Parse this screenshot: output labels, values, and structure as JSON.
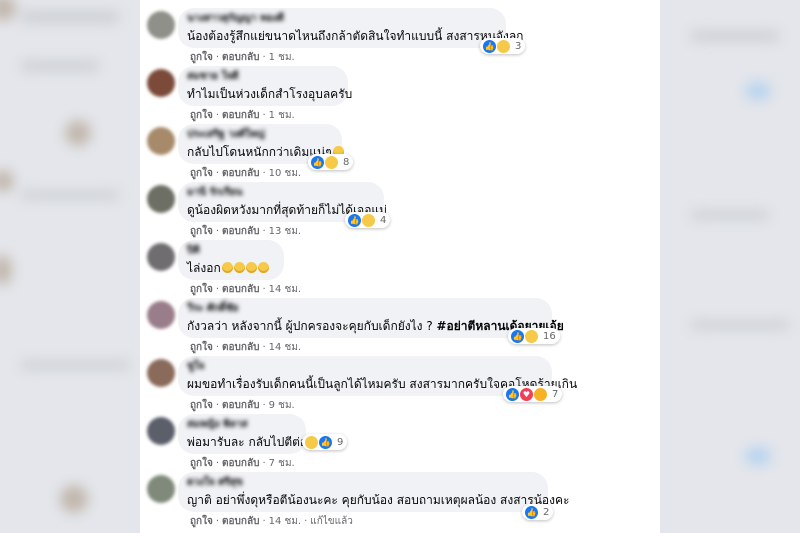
{
  "comments": [
    {
      "author": "นางสาวสุกัญญา ทองดี",
      "text": "น้องต้องรู้สึกแย่ขนาดไหนถึงกล้าตัดสินใจทำแบบนี้ สงสารหนูจังลูก",
      "emojis": 0,
      "tag": "",
      "reactions": [
        "like",
        "sad"
      ],
      "count": "3",
      "like": "ถูกใจ",
      "reply": "ตอบกลับ",
      "time": "1 ชม.",
      "edited": "",
      "avatar_color": "#8f9089"
    },
    {
      "author": "สมชาย ใจดี",
      "text": "ทำไมเป็นห่วงเด็กสำโรงอุบลครับ",
      "emojis": 0,
      "tag": "",
      "reactions": [],
      "count": "",
      "like": "ถูกใจ",
      "reply": "ตอบกลับ",
      "time": "1 ชม.",
      "edited": "",
      "avatar_color": "#7b4a39"
    },
    {
      "author": "ประเสริฐ วงศ์ใหญ่",
      "text": "กลับไปโดนหนักกว่าเดิมแน่ๆ",
      "emojis": 1,
      "tag": "",
      "reactions": [
        "like",
        "sad"
      ],
      "count": "8",
      "like": "ถูกใจ",
      "reply": "ตอบกลับ",
      "time": "10 ชม.",
      "edited": "",
      "avatar_color": "#a78a6a"
    },
    {
      "author": "มานี รักเรียน",
      "text": "ดูน้องผิดหวังมากที่สุดท้ายก็ไม่ได้เจอแม่",
      "emojis": 0,
      "tag": "",
      "reactions": [
        "like",
        "sad"
      ],
      "count": "4",
      "like": "ถูกใจ",
      "reply": "ตอบกลับ",
      "time": "13 ชม.",
      "edited": "",
      "avatar_color": "#6d6f64"
    },
    {
      "author": "ปิติ",
      "text": "ไล่งอก",
      "emojis": 4,
      "tag": "",
      "reactions": [],
      "count": "",
      "like": "ถูกใจ",
      "reply": "ตอบกลับ",
      "time": "14 ชม.",
      "edited": "",
      "avatar_color": "#706d70"
    },
    {
      "author": "วีระ ศักดิ์ชัย",
      "text": "กังวลว่า หลังจากนี้ ผู้ปกครองจะคุยกับเด็กยังไง ? ",
      "emojis": 0,
      "tag": "#อย่าตีหลานเด้อยายเอ้ย",
      "reactions": [
        "like",
        "sad"
      ],
      "count": "16",
      "like": "ถูกใจ",
      "reply": "ตอบกลับ",
      "time": "14 ชม.",
      "edited": "",
      "avatar_color": "#9a7d8a"
    },
    {
      "author": "ชูใจ",
      "text": "ผมขอทำเรื่องรับเด็กคนนี้เป็นลูกได้ไหมครับ สงสารมากครับใจคอโหดร้ายเกิน",
      "emojis": 0,
      "tag": "",
      "reactions": [
        "like",
        "love",
        "haha"
      ],
      "count": "7",
      "like": "ถูกใจ",
      "reply": "ตอบกลับ",
      "time": "9 ชม.",
      "edited": "",
      "avatar_color": "#8a6a5a"
    },
    {
      "author": "สมหญิง พิลาส",
      "text": "พ่อมารับละ กลับไปตีต่อ",
      "emojis": 0,
      "tag": "",
      "reactions": [
        "sad",
        "like"
      ],
      "count": "9",
      "like": "ถูกใจ",
      "reply": "ตอบกลับ",
      "time": "7 ชม.",
      "edited": "",
      "avatar_color": "#5a5f6a"
    },
    {
      "author": "ดวงใจ ศรีสุข",
      "text": "ญาติ อย่าพึ่งดุหรือตีน้องนะคะ คุยกับน้อง สอบถามเหตุผลน้อง สงสารน้องคะ",
      "emojis": 0,
      "tag": "",
      "reactions": [
        "like"
      ],
      "count": "2",
      "like": "ถูกใจ",
      "reply": "ตอบกลับ",
      "time": "14 ชม.",
      "edited": "แก้ไขแล้ว",
      "avatar_color": "#7f8a7a"
    }
  ]
}
